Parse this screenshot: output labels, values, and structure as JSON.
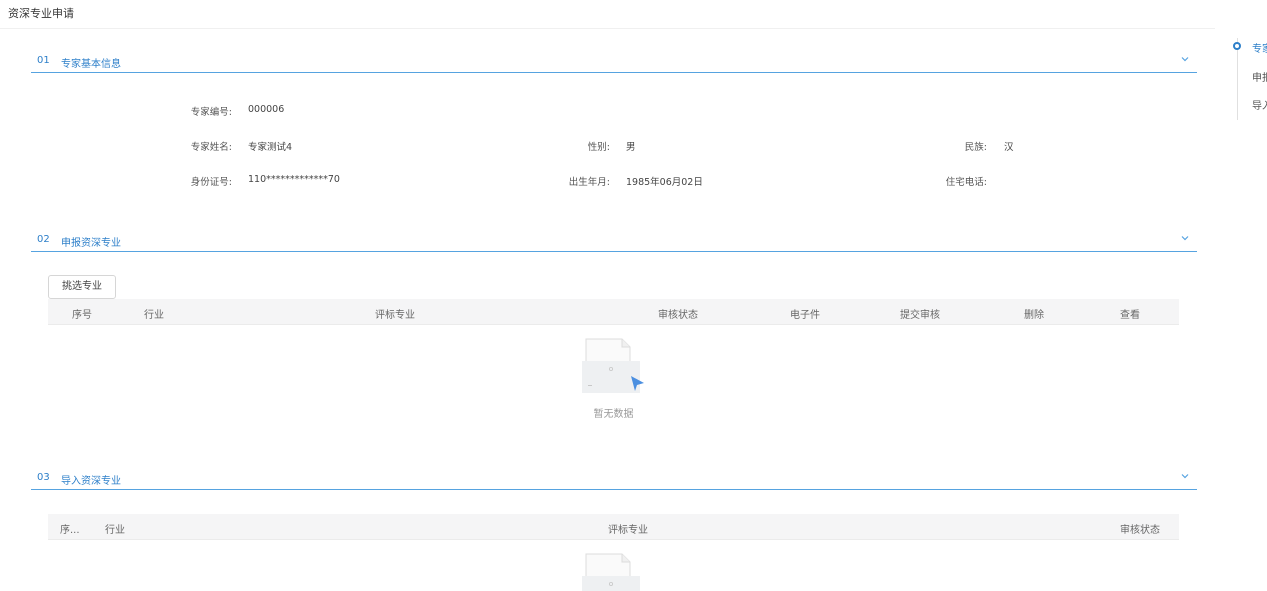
{
  "page": {
    "title": "资深专业申请"
  },
  "sections": {
    "s1": {
      "num": "01",
      "title": "专家基本信息"
    },
    "s2": {
      "num": "02",
      "title": "申报资深专业"
    },
    "s3": {
      "num": "03",
      "title": "导入资深专业"
    }
  },
  "basic_info": {
    "expert_no": {
      "label": "专家编号:",
      "value": "000006"
    },
    "name": {
      "label": "专家姓名:",
      "value": "专家测试4"
    },
    "gender": {
      "label": "性别:",
      "value": "男"
    },
    "ethnicity": {
      "label": "民族:",
      "value": "汉"
    },
    "id_no": {
      "label": "身份证号:",
      "value": "110*************70"
    },
    "birth": {
      "label": "出生年月:",
      "value": "1985年06月02日"
    },
    "home_phone": {
      "label": "住宅电话:",
      "value": ""
    }
  },
  "declare": {
    "select_button": "挑选专业",
    "columns": [
      "序号",
      "行业",
      "评标专业",
      "审核状态",
      "电子件",
      "提交审核",
      "删除",
      "查看"
    ],
    "empty_text": "暂无数据"
  },
  "import": {
    "columns": [
      "序...",
      "行业",
      "评标专业",
      "审核状态"
    ]
  },
  "anchor_nav": {
    "items": [
      "专家",
      "申报",
      "导入"
    ],
    "active_color": "#2d7fc9"
  },
  "colors": {
    "accent": "#2d7fc9",
    "rule": "#56a3e0"
  }
}
